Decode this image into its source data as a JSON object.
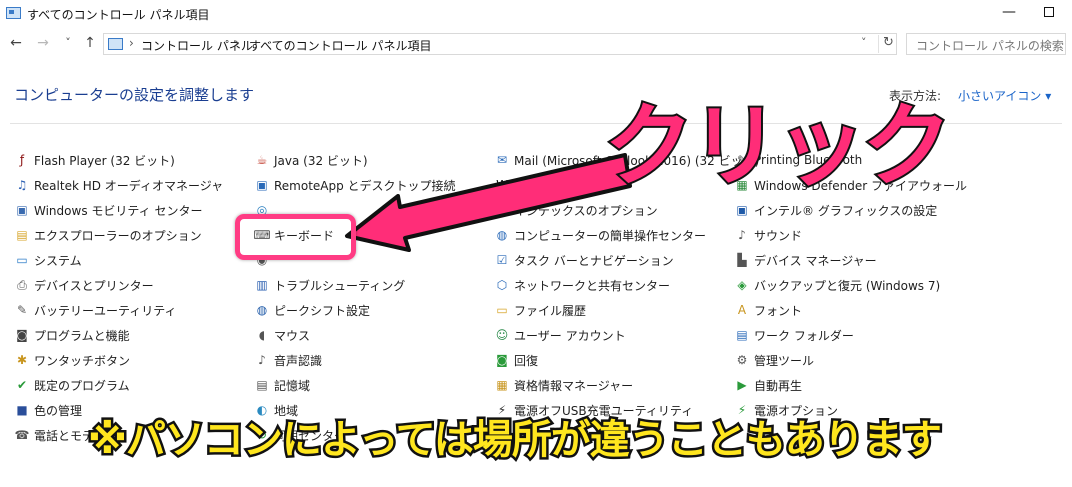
{
  "window": {
    "title": "すべてのコントロール パネル項目",
    "minimize_glyph": "—"
  },
  "nav": {
    "back_glyph": "←",
    "forward_glyph": "→",
    "recent_glyph": "˅",
    "up_glyph": "↑",
    "breadcrumbs": [
      "コントロール パネル",
      "すべてのコントロール パネル項目"
    ],
    "breadcrumb_sep": "›",
    "dropdown_glyph": "˅",
    "refresh_glyph": "↻",
    "search_placeholder": "コントロール パネルの検索"
  },
  "header": {
    "heading": "コンピューターの設定を調整します",
    "view_by_label": "表示方法:",
    "view_by_value": "小さいアイコン ▾"
  },
  "items": {
    "col1": [
      {
        "label": "Flash Player (32 ビット)",
        "icon": "flash-icon",
        "glyph": "ƒ",
        "color": "#8a1010"
      },
      {
        "label": "Realtek HD オーディオマネージャ",
        "icon": "audio-manager-icon",
        "glyph": "♫",
        "color": "#2b5fb3"
      },
      {
        "label": "Windows モビリティ センター",
        "icon": "mobility-center-icon",
        "glyph": "▣",
        "color": "#3a6bb0"
      },
      {
        "label": "エクスプローラーのオプション",
        "icon": "folder-options-icon",
        "glyph": "▤",
        "color": "#d7a62b"
      },
      {
        "label": "システム",
        "icon": "system-icon",
        "glyph": "▭",
        "color": "#2d7cc8"
      },
      {
        "label": "デバイスとプリンター",
        "icon": "printer-icon",
        "glyph": "⎙",
        "color": "#555555"
      },
      {
        "label": "バッテリーユーティリティ",
        "icon": "battery-icon",
        "glyph": "✎",
        "color": "#5a5a5a"
      },
      {
        "label": "プログラムと機能",
        "icon": "programs-icon",
        "glyph": "◙",
        "color": "#444444"
      },
      {
        "label": "ワンタッチボタン",
        "icon": "one-touch-icon",
        "glyph": "✱",
        "color": "#c8951e"
      },
      {
        "label": "既定のプログラム",
        "icon": "default-programs-icon",
        "glyph": "✔",
        "color": "#2a9a3a"
      },
      {
        "label": "色の管理",
        "icon": "color-management-icon",
        "glyph": "■",
        "color": "#2a4e9a"
      },
      {
        "label": "電話とモデム",
        "icon": "phone-modem-icon",
        "glyph": "☎",
        "color": "#555555"
      }
    ],
    "col2": [
      {
        "label": "Java (32 ビット)",
        "icon": "java-icon",
        "glyph": "☕",
        "color": "#c0392b"
      },
      {
        "label": "RemoteApp とデスクトップ接続",
        "icon": "remoteapp-icon",
        "glyph": "▣",
        "color": "#2a6ab8"
      },
      {
        "label": "",
        "icon": "hidden-item-icon",
        "glyph": "◎",
        "color": "#2a7fc0"
      },
      {
        "label": "キーボード",
        "icon": "keyboard-icon",
        "glyph": "⌨",
        "color": "#555555"
      },
      {
        "label": "",
        "icon": "hidden-item-icon",
        "glyph": "◉",
        "color": "#555555"
      },
      {
        "label": "トラブルシューティング",
        "icon": "troubleshoot-icon",
        "glyph": "▥",
        "color": "#2a5fb0"
      },
      {
        "label": "ピークシフト設定",
        "icon": "peak-shift-icon",
        "glyph": "◍",
        "color": "#1f5aa8"
      },
      {
        "label": "マウス",
        "icon": "mouse-icon",
        "glyph": "◖",
        "color": "#555555"
      },
      {
        "label": "音声認識",
        "icon": "speech-icon",
        "glyph": "♪",
        "color": "#555555"
      },
      {
        "label": "記憶域",
        "icon": "storage-icon",
        "glyph": "▤",
        "color": "#555555"
      },
      {
        "label": "地域",
        "icon": "region-icon",
        "glyph": "◐",
        "color": "#2a8ac0"
      },
      {
        "label": "同期センター",
        "icon": "sync-center-icon",
        "glyph": "↻",
        "color": "#2a9a3a"
      }
    ],
    "col3": [
      {
        "label": "Mail (Microsoft Outlook 2016) (32 ビット)",
        "icon": "mail-icon",
        "glyph": "✉",
        "color": "#2a6ab8"
      },
      {
        "label": "Waves MaxxAudio",
        "icon": "waves-icon",
        "glyph": "W",
        "color": "#111111"
      },
      {
        "label": "インデックスのオプション",
        "icon": "indexing-icon",
        "glyph": "⌕",
        "color": "#555555"
      },
      {
        "label": "コンピューターの簡単操作センター",
        "icon": "ease-of-access-icon",
        "glyph": "◍",
        "color": "#2a6ab8"
      },
      {
        "label": "タスク バーとナビゲーション",
        "icon": "taskbar-icon",
        "glyph": "☑",
        "color": "#2a6ab8"
      },
      {
        "label": "ネットワークと共有センター",
        "icon": "network-icon",
        "glyph": "⬡",
        "color": "#2a6ab8"
      },
      {
        "label": "ファイル履歴",
        "icon": "file-history-icon",
        "glyph": "▭",
        "color": "#d7a62b"
      },
      {
        "label": "ユーザー アカウント",
        "icon": "user-accounts-icon",
        "glyph": "☺",
        "color": "#2a8a4a"
      },
      {
        "label": "回復",
        "icon": "recovery-icon",
        "glyph": "◙",
        "color": "#2a9a3a"
      },
      {
        "label": "資格情報マネージャー",
        "icon": "credential-manager-icon",
        "glyph": "▦",
        "color": "#c8951e"
      },
      {
        "label": "電源オフUSB充電ユーティリティ",
        "icon": "usb-charge-icon",
        "glyph": "⚡",
        "color": "#333333"
      },
      {
        "label": "",
        "icon": "hidden-item-icon",
        "glyph": "◌",
        "color": "#555555"
      }
    ],
    "col4": [
      {
        "label": "Printing Bluetooth",
        "icon": "bluetooth-printing-icon",
        "glyph": "✎",
        "color": "#555555"
      },
      {
        "label": "Windows Defender ファイアウォール",
        "icon": "firewall-icon",
        "glyph": "▦",
        "color": "#2a8a3a"
      },
      {
        "label": "インテル® グラフィックスの設定",
        "icon": "intel-graphics-icon",
        "glyph": "▣",
        "color": "#1f5aa8"
      },
      {
        "label": "サウンド",
        "icon": "sound-icon",
        "glyph": "♪",
        "color": "#555555"
      },
      {
        "label": "デバイス マネージャー",
        "icon": "device-manager-icon",
        "glyph": "▙",
        "color": "#555555"
      },
      {
        "label": "バックアップと復元 (Windows 7)",
        "icon": "backup-icon",
        "glyph": "◈",
        "color": "#2a9a3a"
      },
      {
        "label": "フォント",
        "icon": "fonts-icon",
        "glyph": "A",
        "color": "#c8951e"
      },
      {
        "label": "ワーク フォルダー",
        "icon": "work-folders-icon",
        "glyph": "▤",
        "color": "#2a6ab8"
      },
      {
        "label": "管理ツール",
        "icon": "admin-tools-icon",
        "glyph": "⚙",
        "color": "#555555"
      },
      {
        "label": "自動再生",
        "icon": "autoplay-icon",
        "glyph": "▶",
        "color": "#2a9a3a"
      },
      {
        "label": "電源オプション",
        "icon": "power-options-icon",
        "glyph": "⚡",
        "color": "#2a9a3a"
      }
    ]
  },
  "annotation": {
    "click_text": "クリック",
    "notice_text": "※パソコンによっては場所が違うこともあります",
    "accent_color": "#ff2d78",
    "notice_color": "#ffe61e"
  }
}
